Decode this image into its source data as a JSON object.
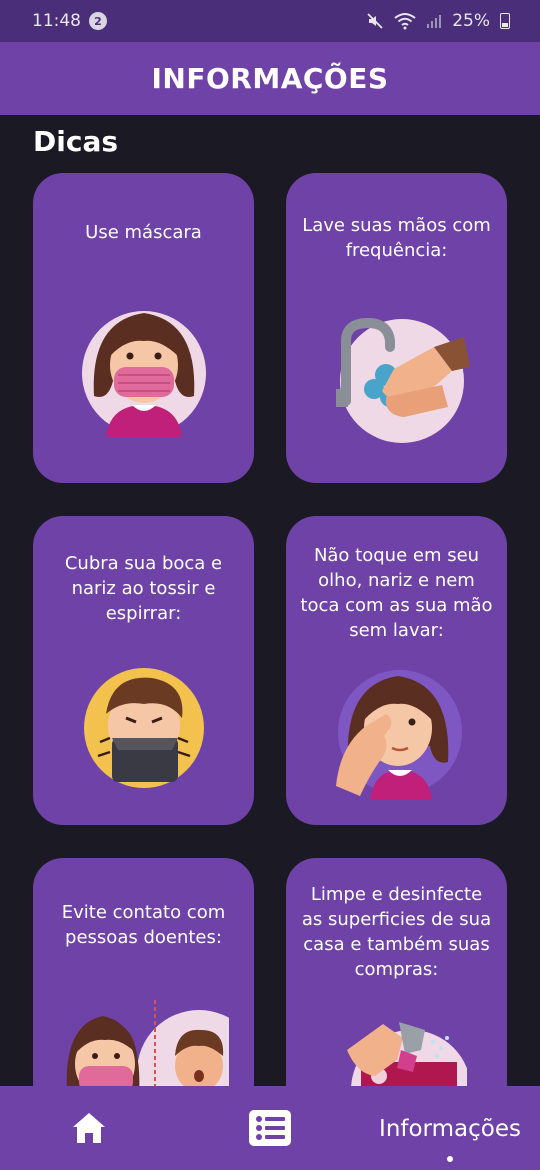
{
  "status_bar": {
    "time": "11:48",
    "notification_count": "2",
    "battery": "25%",
    "icons": [
      "mute-icon",
      "wifi-icon",
      "signal-icon",
      "battery-icon"
    ]
  },
  "app_bar": {
    "title": "INFORMAÇÕES"
  },
  "section": {
    "title": "Dicas"
  },
  "cards": [
    {
      "text": "Use máscara",
      "icon": "mask-girl-illustration"
    },
    {
      "text": "Lave suas mãos com frequência:",
      "icon": "handwashing-illustration"
    },
    {
      "text": "Cubra sua boca e nariz ao tossir e espirrar:",
      "icon": "cough-boy-illustration"
    },
    {
      "text": "Não toque em seu olho, nariz e nem toca com as sua mão sem lavar:",
      "icon": "face-touch-girl-illustration"
    },
    {
      "text": "Evite contato com pessoas doentes:",
      "icon": "distance-illustration"
    },
    {
      "text": "Limpe e desinfecte as superficies de sua casa e também suas compras:",
      "icon": "disinfect-illustration"
    }
  ],
  "bottom_nav": {
    "items": [
      {
        "icon": "home-icon"
      },
      {
        "icon": "list-icon"
      },
      {
        "label": "Informações"
      }
    ],
    "active_index": 2
  },
  "colors": {
    "status_bar": "#4a2e7a",
    "primary": "#6f42a8",
    "background": "#1b1a24"
  }
}
